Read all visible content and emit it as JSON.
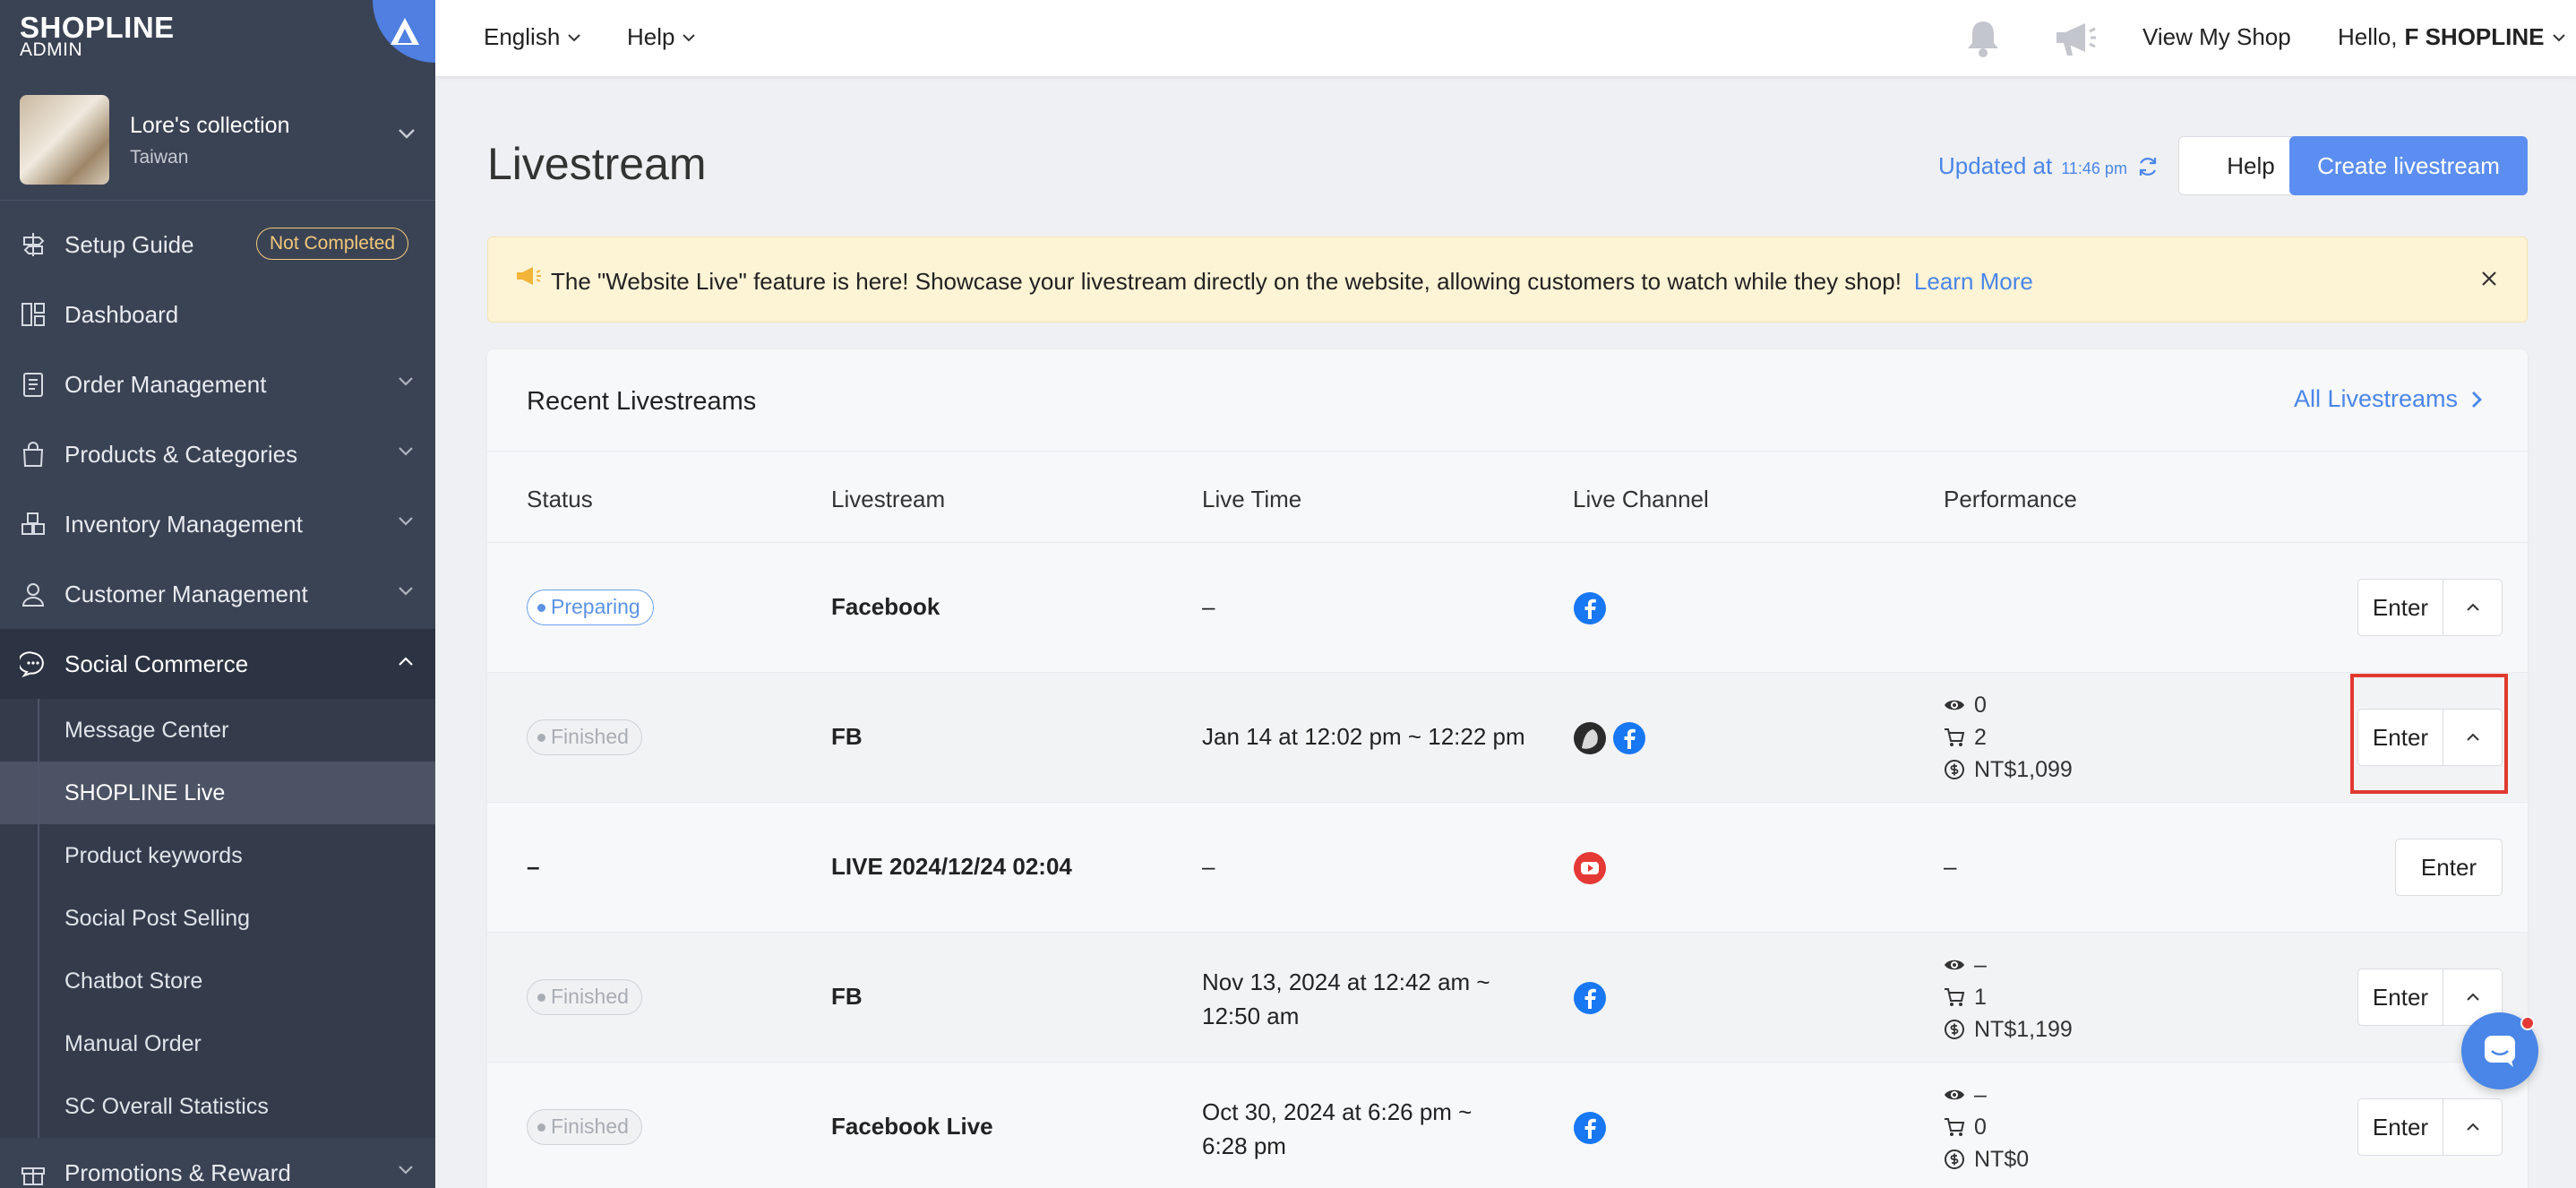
{
  "sidebar": {
    "logo": "SHOPLINE",
    "logo_sub": "ADMIN",
    "store_name": "Lore's collection",
    "store_country": "Taiwan",
    "items": [
      {
        "label": "Setup Guide",
        "badge": "Not Completed"
      },
      {
        "label": "Dashboard"
      },
      {
        "label": "Order Management"
      },
      {
        "label": "Products & Categories"
      },
      {
        "label": "Inventory Management"
      },
      {
        "label": "Customer Management"
      },
      {
        "label": "Social Commerce"
      },
      {
        "label": "Promotions & Reward"
      }
    ],
    "sub_items": [
      {
        "label": "Message Center"
      },
      {
        "label": "SHOPLINE Live"
      },
      {
        "label": "Product keywords"
      },
      {
        "label": "Social Post Selling"
      },
      {
        "label": "Chatbot Store"
      },
      {
        "label": "Manual Order"
      },
      {
        "label": "SC Overall Statistics"
      }
    ]
  },
  "topbar": {
    "language": "English",
    "help": "Help",
    "view_shop": "View My Shop",
    "hello": "Hello,",
    "user": "F SHOPLINE"
  },
  "page": {
    "title": "Livestream",
    "updated_label": "Updated at",
    "updated_time": "11:46 pm",
    "help_button": "Help",
    "create_button": "Create livestream"
  },
  "banner": {
    "text": "The \"Website Live\" feature is here! Showcase your livestream directly on the website, allowing customers to watch while they shop!",
    "link": "Learn More"
  },
  "recent": {
    "title": "Recent Livestreams",
    "all_link": "All Livestreams",
    "columns": [
      "Status",
      "Livestream",
      "Live Time",
      "Live Channel",
      "Performance"
    ],
    "enter_label": "Enter",
    "rows": [
      {
        "status": "Preparing",
        "name": "Facebook",
        "time1": "–",
        "time2": "",
        "views": "",
        "orders": "",
        "sales": "",
        "perf_dash": ""
      },
      {
        "status": "Finished",
        "name": "FB",
        "time1": "Jan 14 at 12:02 pm ~ 12:22 pm",
        "time2": "",
        "views": "0",
        "orders": "2",
        "sales": "NT$1,099",
        "perf_dash": ""
      },
      {
        "status": "–",
        "name": "LIVE 2024/12/24 02:04",
        "time1": "–",
        "time2": "",
        "views": "",
        "orders": "",
        "sales": "",
        "perf_dash": "–"
      },
      {
        "status": "Finished",
        "name": "FB",
        "time1": "Nov 13, 2024 at 12:42 am ~",
        "time2": "12:50 am",
        "views": "–",
        "orders": "1",
        "sales": "NT$1,199",
        "perf_dash": ""
      },
      {
        "status": "Finished",
        "name": "Facebook Live",
        "time1": "Oct 30, 2024 at 6:26 pm ~",
        "time2": "6:28 pm",
        "views": "–",
        "orders": "0",
        "sales": "NT$0",
        "perf_dash": ""
      }
    ]
  },
  "colors": {
    "sidebar_bg": "#3a4354",
    "accent": "#4a86e8",
    "banner_bg": "#fdf3d5",
    "highlight": "#e03a2f",
    "facebook": "#1877f2",
    "youtube": "#e53935"
  }
}
